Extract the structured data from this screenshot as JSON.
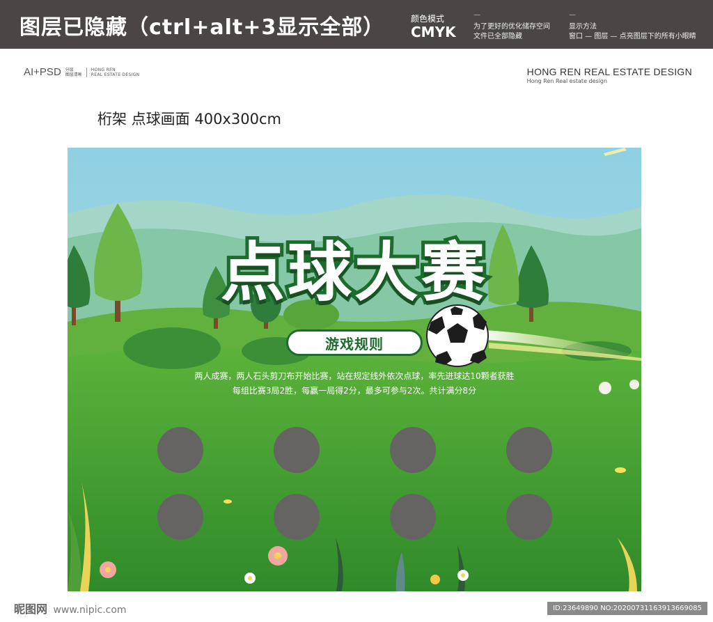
{
  "topbar": {
    "hidden_title": "图层已隐藏（ctrl+alt+3显示全部）",
    "mode_label": "颜色模式",
    "mode_value": "CMYK",
    "note1_line1": "为了更好的优化储存空间",
    "note1_line2": "文件已全部隐藏",
    "note2_line1": "显示方法",
    "note2_line2": "窗口 — 图层 — 点亮图层下的所有小眼睛",
    "dash": "—"
  },
  "header": {
    "logo_text": "AI+PSD",
    "logo_small_1": "分层",
    "logo_small_2": "图层清晰",
    "logo_brand_1": "HONG REN",
    "logo_brand_2": "REAL ESTATE DESIGN",
    "brand_main": "HONG REN REAL ESTATE DESIGN",
    "brand_sub": "Hong Ren Real estate design"
  },
  "spec_line": "桁架  点球画面   400x300cm",
  "poster": {
    "title": "点球大赛",
    "rules_label": "游戏规则",
    "rule_line1": "两人成赛，两人石头剪刀布开始比赛，站在规定线外依次点球，率先进球达10颗者获胜",
    "rule_line2": "每组比赛3局2胜，每赢一局得2分，最多可参与2次。共计满分8分"
  },
  "watermark": {
    "left_brand": "昵图网",
    "left_url": "www.nipic.com",
    "right_id": "ID:23649890 NO:20200731163913669085"
  },
  "colors": {
    "sky": "#8fd0e2",
    "grass": "#3f9a2e",
    "dark_green": "#1e6b2e",
    "hole": "#666462",
    "topbar": "#4a4646"
  }
}
